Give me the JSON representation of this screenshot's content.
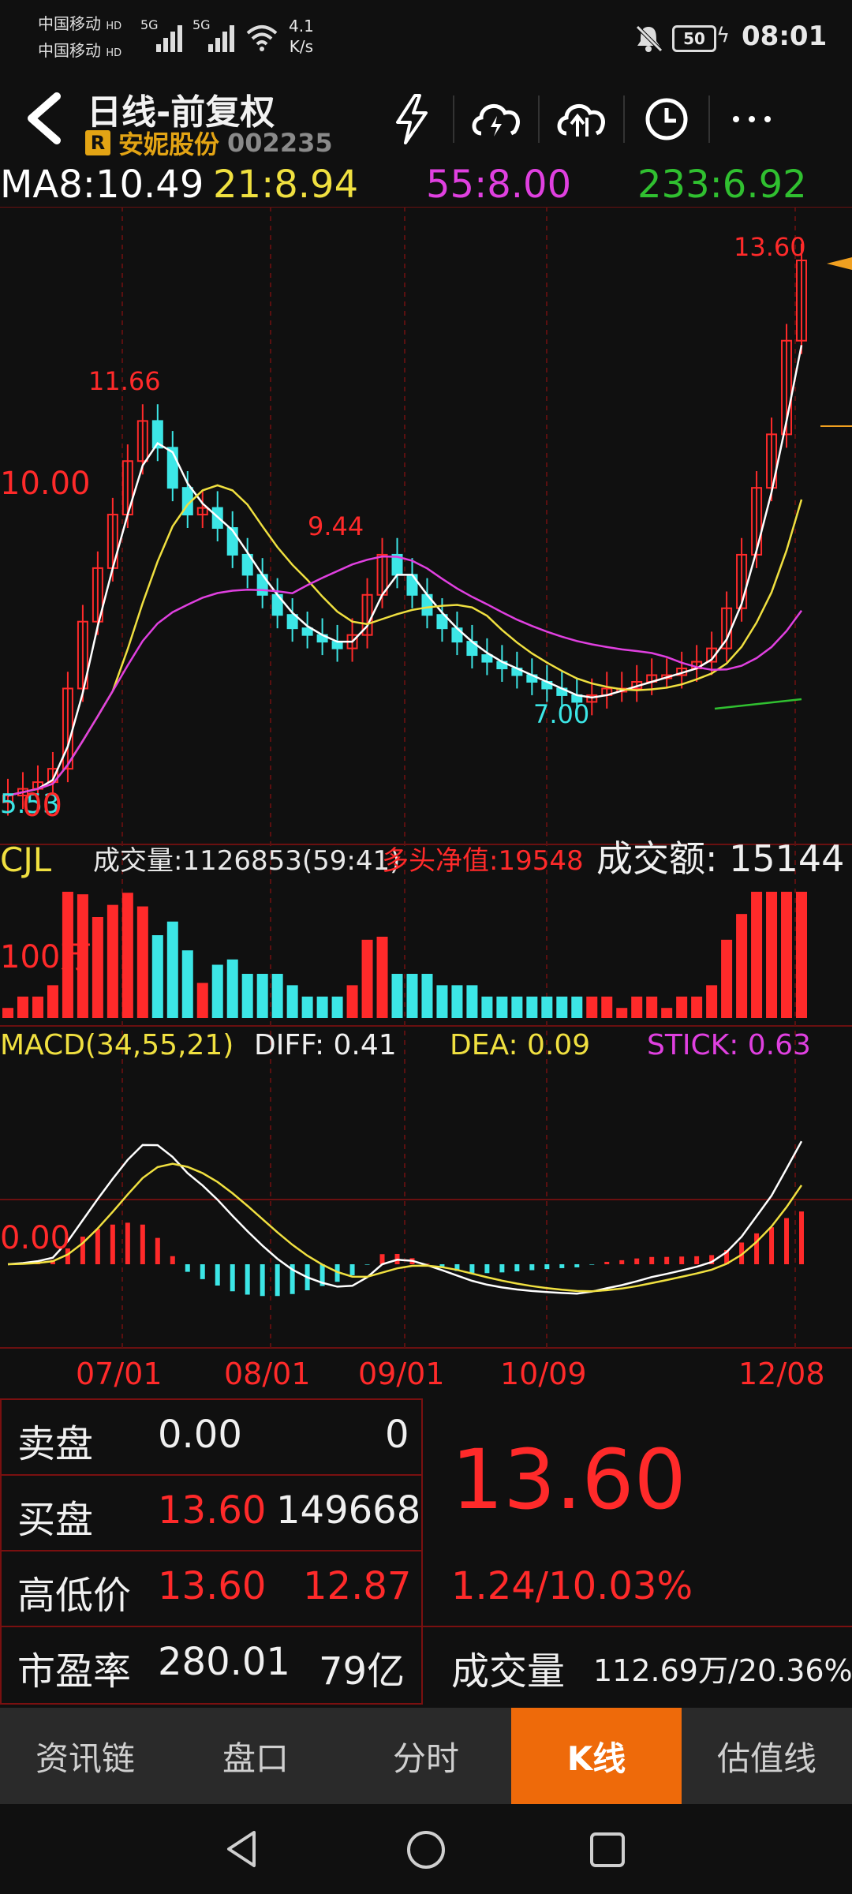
{
  "status_bar": {
    "carrier1": "中国移动",
    "carrier2": "中国移动",
    "hd1": "HD",
    "hd2": "HD",
    "net1": "5G",
    "net2": "5G",
    "speed_value": "4.1",
    "speed_unit": "K/s",
    "battery": "50",
    "time": "08:01"
  },
  "header": {
    "title": "日线-前复权",
    "badge": "R",
    "stock_name": "安妮股份",
    "stock_code": "002235",
    "icons": [
      "flash-icon",
      "cloud-download-icon",
      "cloud-upload-icon",
      "clock-icon",
      "more-icon"
    ]
  },
  "ma_line": {
    "ma8": "MA8:10.49",
    "ma21": "21:8.94",
    "ma55": "55:8.00",
    "ma233": "233:6.92"
  },
  "price_chart": {
    "high_label": "13.60",
    "peak1_label": "11.66",
    "axis_label_10": "10.00",
    "peak2_label": "9.44",
    "low_label": "7.00",
    "start_label": "5.53",
    "axis_label_0": "00"
  },
  "volume_panel": {
    "cjl_label": "CJL",
    "volume_text": "成交量:1126853(59:41)",
    "net_text": "多头净值:19548",
    "amount_text": "成交额: 15144",
    "axis_label": "100万"
  },
  "macd_panel": {
    "title": "MACD(34,55,21)",
    "diff": "DIFF: 0.41",
    "dea": "DEA: 0.09",
    "stick": "STICK: 0.63",
    "zero_label": "0.00"
  },
  "date_axis": [
    "07/01",
    "08/01",
    "09/01",
    "10/09",
    "12/08"
  ],
  "quote_table": {
    "sell_label": "卖盘",
    "sell_price": "0.00",
    "sell_vol": "0",
    "buy_label": "买盘",
    "buy_price": "13.60",
    "buy_vol": "149668",
    "hl_label": "高低价",
    "high": "13.60",
    "low": "12.87",
    "pe_label": "市盈率",
    "pe": "280.01",
    "mcap": "79亿",
    "last_price": "13.60",
    "change": "1.24/10.03%",
    "vol_label": "成交量",
    "vol_value": "112.69万/20.36%"
  },
  "tabs": [
    {
      "label": "资讯链",
      "active": false
    },
    {
      "label": "盘口",
      "active": false
    },
    {
      "label": "分时",
      "active": false
    },
    {
      "label": "K线",
      "active": true
    },
    {
      "label": "估值线",
      "active": false
    }
  ],
  "colors": {
    "up": "#ff2a2a",
    "down": "#3ce6e6",
    "ma8": "#ffffff",
    "ma21": "#f0e040",
    "ma55": "#e040e0",
    "ma233": "#30c030",
    "accent": "#ee6a0a"
  },
  "chart_data": {
    "type": "candlestick",
    "x": [
      "07/01",
      "08/01",
      "09/01",
      "10/09",
      "12/08"
    ],
    "price_labels": {
      "high": 13.6,
      "peak1": 11.66,
      "peak2": 9.44,
      "low": 7.0,
      "start": 5.53,
      "gridline": 10.0
    },
    "close_series_approx": [
      5.6,
      5.7,
      5.8,
      6.0,
      7.2,
      8.2,
      9.0,
      9.8,
      10.6,
      11.2,
      10.8,
      10.2,
      9.8,
      9.9,
      9.6,
      9.2,
      8.9,
      8.6,
      8.3,
      8.1,
      8.0,
      7.9,
      7.8,
      8.0,
      8.6,
      9.2,
      8.9,
      8.6,
      8.3,
      8.1,
      7.9,
      7.7,
      7.6,
      7.5,
      7.4,
      7.3,
      7.2,
      7.1,
      7.0,
      7.1,
      7.2,
      7.2,
      7.3,
      7.4,
      7.4,
      7.5,
      7.6,
      7.8,
      8.4,
      9.2,
      10.2,
      11.0,
      12.4,
      13.6
    ],
    "macd": {
      "diff": 0.41,
      "dea": 0.09,
      "stick": 0.63
    }
  }
}
